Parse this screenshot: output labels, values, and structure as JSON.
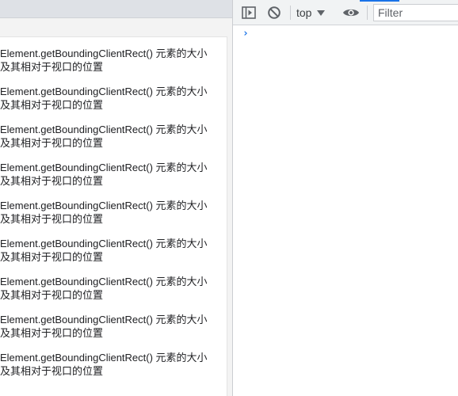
{
  "page": {
    "items": [
      {
        "line1": "Element.getBoundingClientRect() 元素的大小",
        "line2": "及其相对于视口的位置"
      },
      {
        "line1": "Element.getBoundingClientRect() 元素的大小",
        "line2": "及其相对于视口的位置"
      },
      {
        "line1": "Element.getBoundingClientRect() 元素的大小",
        "line2": "及其相对于视口的位置"
      },
      {
        "line1": "Element.getBoundingClientRect() 元素的大小",
        "line2": "及其相对于视口的位置"
      },
      {
        "line1": "Element.getBoundingClientRect() 元素的大小",
        "line2": "及其相对于视口的位置"
      },
      {
        "line1": "Element.getBoundingClientRect() 元素的大小",
        "line2": "及其相对于视口的位置"
      },
      {
        "line1": "Element.getBoundingClientRect() 元素的大小",
        "line2": "及其相对于视口的位置"
      },
      {
        "line1": "Element.getBoundingClientRect() 元素的大小",
        "line2": "及其相对于视口的位置"
      },
      {
        "line1": "Element.getBoundingClientRect() 元素的大小",
        "line2": "及其相对于视口的位置"
      }
    ]
  },
  "console": {
    "toolbar": {
      "sidebar_icon": "sidebar-toggle-icon",
      "clear_icon": "clear-console-icon",
      "context_label": "top",
      "eye_icon": "live-expression-eye-icon",
      "filter_placeholder": "Filter"
    },
    "prompt_icon": "›",
    "accent_color": "#1a73e8"
  }
}
